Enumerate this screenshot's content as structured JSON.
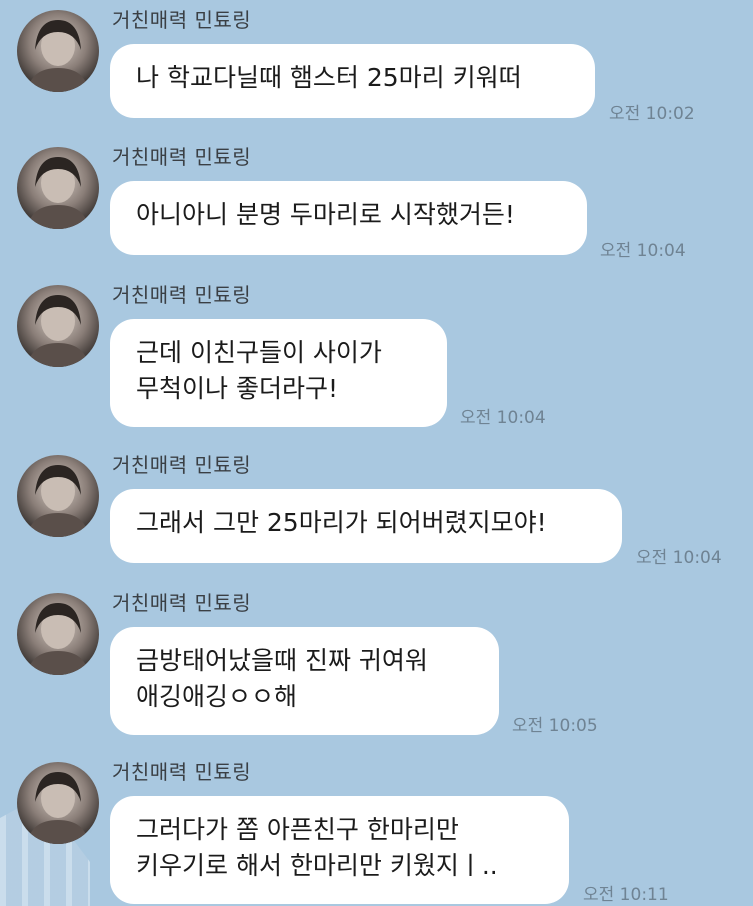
{
  "chat": {
    "messages": [
      {
        "sender": "거친매력 민툐링",
        "text": "나 학교다닐때 햄스터 25마리 키워떠",
        "time": "오전 10:02"
      },
      {
        "sender": "거친매력 민툐링",
        "text": "아니아니 분명 두마리로 시작했거든!",
        "time": "오전 10:04"
      },
      {
        "sender": "거친매력 민툐링",
        "text": "근데 이친구들이 사이가\n무척이나 좋더라구!",
        "time": "오전 10:04"
      },
      {
        "sender": "거친매력 민툐링",
        "text": "그래서 그만 25마리가 되어버렸지모야!",
        "time": "오전 10:04"
      },
      {
        "sender": "거친매력 민툐링",
        "text": "금방태어났을때 진짜 귀여워\n애깅애깅ㅇㅇ해",
        "time": "오전 10:05"
      },
      {
        "sender": "거친매력 민툐링",
        "text": "그러다가 쫌 아픈친구 한마리만\n키우기로 해서 한마리만 키웠지ㅣ..",
        "time": "오전 10:11"
      }
    ]
  }
}
